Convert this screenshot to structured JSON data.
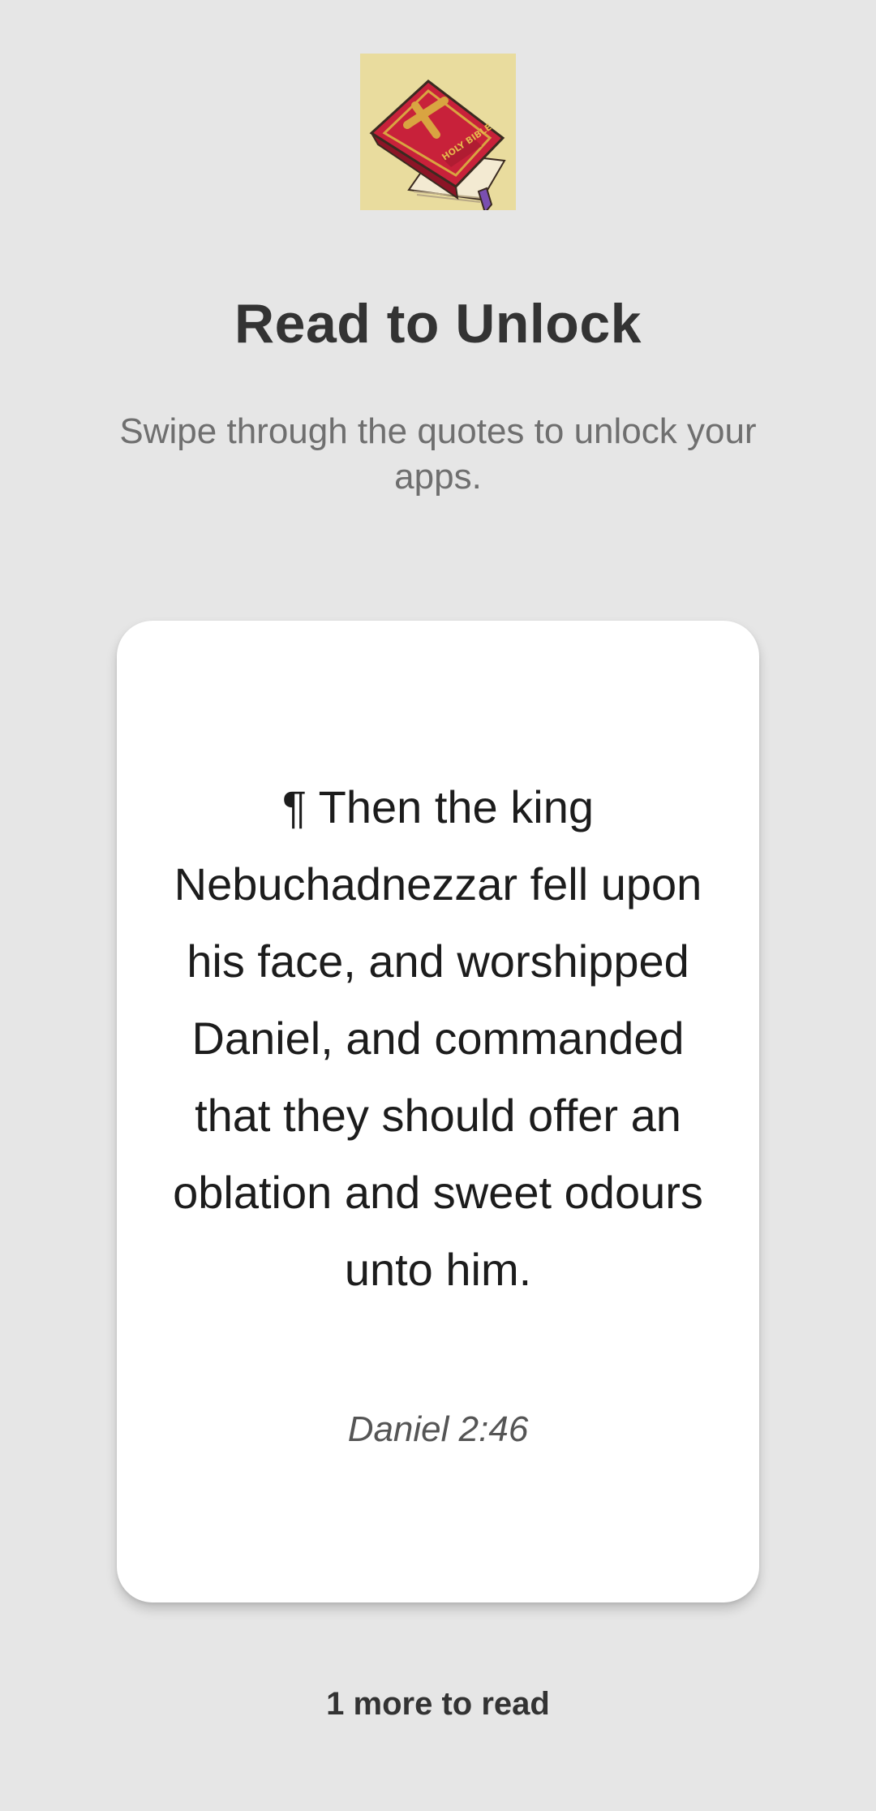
{
  "header": {
    "logo_icon": "holy-bible-book-icon",
    "logo_text": "HOLY BIBLE",
    "title": "Read to Unlock",
    "subtitle": "Swipe through the quotes to unlock your apps."
  },
  "card": {
    "quote": "¶ Then the king Nebuchadnezzar fell upon his face, and worshipped Daniel, and commanded that they should offer an oblation and sweet odours unto him.",
    "reference": "Daniel 2:46"
  },
  "footer": {
    "remaining": "1 more to read"
  },
  "colors": {
    "background": "#e6e6e6",
    "card": "#ffffff",
    "logo_background": "#e9dc9e",
    "bible_red": "#c8213a"
  }
}
